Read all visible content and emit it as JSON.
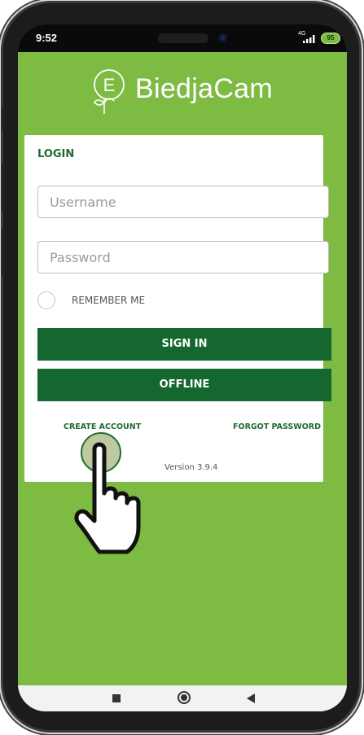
{
  "status_bar": {
    "time": "9:52",
    "network": "4G",
    "battery": "95"
  },
  "app": {
    "logo_letter": "E",
    "name": "BiedjaCam"
  },
  "login": {
    "title": "LOGIN",
    "username_placeholder": "Username",
    "password_placeholder": "Password",
    "remember_label": "REMEMBER ME",
    "sign_in_label": "SIGN IN",
    "offline_label": "OFFLINE",
    "create_account_label": "CREATE ACCOUNT",
    "forgot_password_label": "FORGOT PASSWORD",
    "version": "Version 3.9.4"
  },
  "colors": {
    "background": "#7dbb42",
    "primary": "#14682f",
    "card": "#ffffff"
  }
}
